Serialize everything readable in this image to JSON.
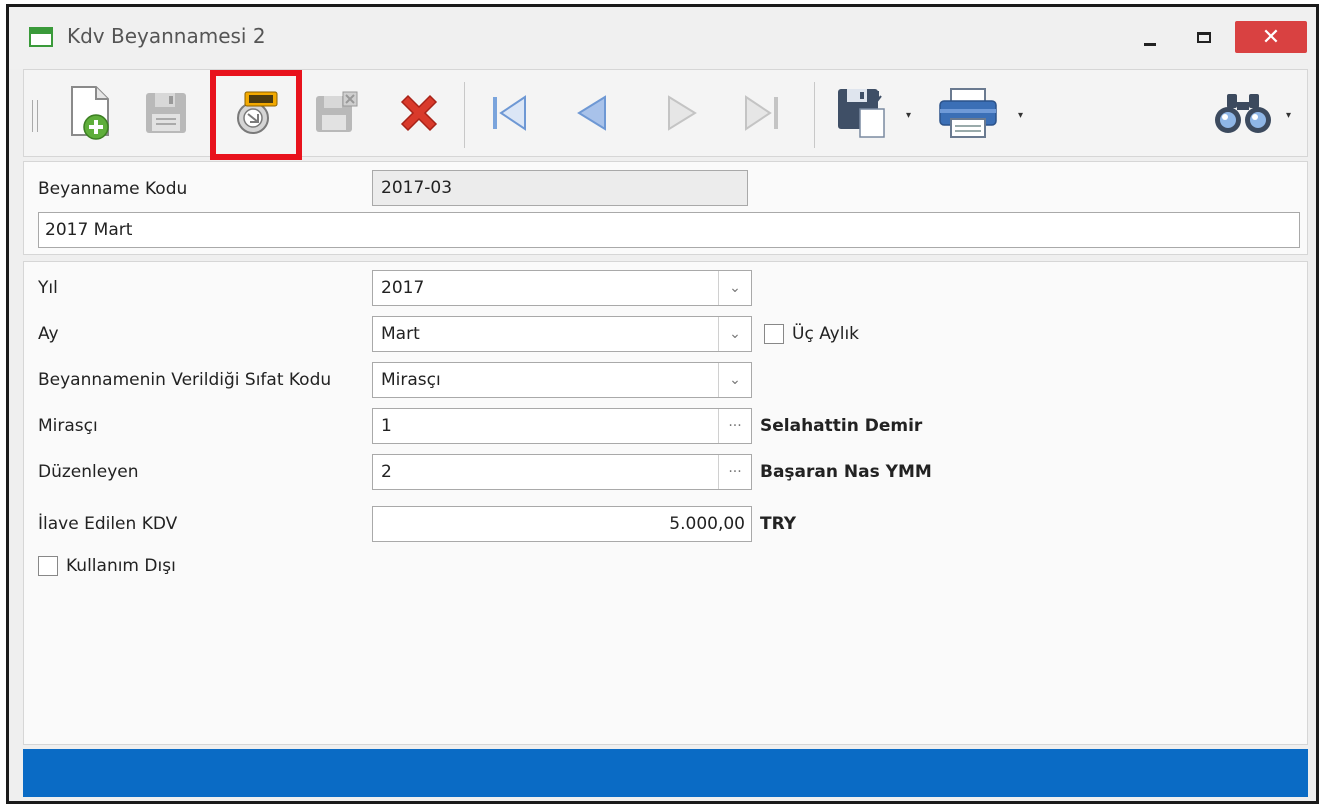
{
  "window": {
    "title": "Kdv Beyannamesi 2",
    "close_glyph": "✕"
  },
  "toolbar": {
    "icons": [
      "new-document-icon",
      "save-icon",
      "xml-export-icon",
      "save-close-icon",
      "delete-icon",
      "first-record-icon",
      "previous-record-icon",
      "next-record-icon",
      "last-record-icon",
      "save-as-icon",
      "print-icon",
      "find-icon"
    ],
    "dropdown_glyph": "▾",
    "highlighted_button": "xml-export-icon",
    "highlight_color": "#e8121c"
  },
  "header": {
    "code_label": "Beyanname Kodu",
    "code_value": "2017-03",
    "description_value": "2017 Mart"
  },
  "form": {
    "year": {
      "label": "Yıl",
      "value": "2017"
    },
    "month": {
      "label": "Ay",
      "value": "Mart"
    },
    "quarterly": {
      "label": "Üç Aylık",
      "checked": false
    },
    "capacity": {
      "label": "Beyannamenin Verildiği Sıfat Kodu",
      "value": "Mirasçı"
    },
    "heir": {
      "label": "Mirasçı",
      "value": "1",
      "name": "Selahattin Demir"
    },
    "preparer": {
      "label": "Düzenleyen",
      "value": "2",
      "name": "Başaran Nas YMM"
    },
    "added_vat": {
      "label": "İlave Edilen KDV",
      "value": "5.000,00",
      "currency": "TRY"
    },
    "disabled": {
      "label": "Kullanım Dışı",
      "checked": false
    },
    "dropdown_glyph": "⌄",
    "ellipsis_glyph": "···"
  },
  "colors": {
    "status_bar": "#0a6bc5",
    "close_button": "#d94141"
  }
}
